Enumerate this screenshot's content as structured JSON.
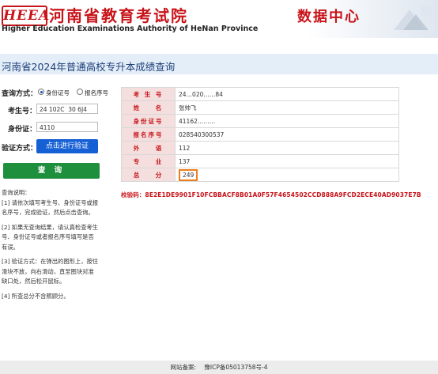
{
  "header": {
    "logo_mark": "HEEA",
    "logo_cn": "河南省教育考试院",
    "logo_en": "Higher Education Examinations Authority of HeNan Province",
    "data_center": "数据中心"
  },
  "page_title": "河南省2024年普通高校专升本成绩查询",
  "form": {
    "method_label": "查询方式：",
    "method_options": [
      "身份证号",
      "报名序号"
    ],
    "selected_method": "身份证号",
    "exam_no_label": "考生号：",
    "exam_no_value": "24 102C  30 6J4",
    "id_label": "身份证：",
    "id_value": "4110",
    "verify_label": "验证方式：",
    "verify_button": "点击进行验证",
    "query_button": "查 询"
  },
  "notes": {
    "title": "查询说明：",
    "items": [
      "[1] 请依次填写考生号、身份证号或报名序号，完成验证，然后点击查询。",
      "[2] 如果无查询结果，请认真检查考生号、身份证号或者报名序号填写是否有误。",
      "[3] 验证方式：在弹出的图形上，按住滑块不放，向右滑动，直至图块对准缺口处，然后松开鼠标。",
      "[4] 所查总分不含照顾分。"
    ]
  },
  "result": {
    "rows": [
      {
        "key": "考 生 号",
        "value": "24…020……84"
      },
      {
        "key": "姓    名",
        "value": "张帅飞"
      },
      {
        "key": "身份证号",
        "value": "41162………"
      },
      {
        "key": "报名序号",
        "value": "028540300537"
      },
      {
        "key": "外    语",
        "value": "112"
      },
      {
        "key": "专    业",
        "value": "137"
      },
      {
        "key": "总    分",
        "value": "249"
      }
    ],
    "checksum_label": "校验码：",
    "checksum_value": "8E2E1DE9901F10FCBBACF8B01A0F57F4654502CCD888A9FCD2ECE40AD9037E7B"
  },
  "footer": {
    "label": "网站备案:",
    "icp": "豫ICP备05013758号-4"
  },
  "colors": {
    "brand_red": "#c8141a",
    "title_blue": "#1f3f7a",
    "verify_blue": "#1660d6",
    "query_green": "#1e8f3c",
    "score_highlight": "#f07d1b"
  }
}
